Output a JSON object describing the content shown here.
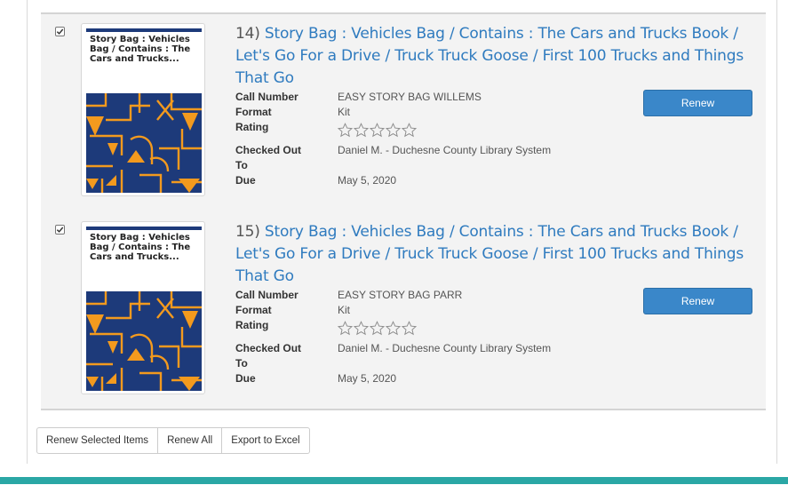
{
  "items": [
    {
      "number": "14)",
      "title_lines": [
        "Story Bag : Vehicles Bag / Contains : The Cars and Trucks Book /",
        "Let's Go For a Drive / Truck Truck Goose / First 100 Trucks and Things",
        "That Go"
      ],
      "cover_title": "Story Bag : Vehicles\nBag / Contains : The\nCars and Trucks...",
      "checked": true,
      "details": {
        "call_number_label": "Call Number",
        "call_number": "EASY STORY BAG WILLEMS",
        "format_label": "Format",
        "format": "Kit",
        "rating_label": "Rating",
        "rating": 0,
        "checked_out_to_label_1": "Checked Out",
        "checked_out_to_label_2": "To",
        "checked_out_to": "Daniel M. - Duchesne County Library System",
        "due_label": "Due",
        "due": "May 5, 2020"
      },
      "renew_label": "Renew"
    },
    {
      "number": "15)",
      "title_lines": [
        "Story Bag : Vehicles Bag / Contains : The Cars and Trucks Book /",
        "Let's Go For a Drive / Truck Truck Goose / First 100 Trucks and Things",
        "That Go"
      ],
      "cover_title": "Story Bag : Vehicles\nBag / Contains : The\nCars and Trucks...",
      "checked": true,
      "details": {
        "call_number_label": "Call Number",
        "call_number": "EASY STORY BAG PARR",
        "format_label": "Format",
        "format": "Kit",
        "rating_label": "Rating",
        "rating": 0,
        "checked_out_to_label_1": "Checked Out",
        "checked_out_to_label_2": "To",
        "checked_out_to": "Daniel M. - Duchesne County Library System",
        "due_label": "Due",
        "due": "May 5, 2020"
      },
      "renew_label": "Renew"
    }
  ],
  "actions": {
    "renew_selected": "Renew Selected Items",
    "renew_all": "Renew All",
    "export_excel": "Export to Excel"
  },
  "colors": {
    "link": "#2f7bbf",
    "renew_button": "#3a87c9",
    "footer_bar": "#2aa7a5",
    "cover_blue": "#1d3a7a",
    "cover_orange": "#f39a1e"
  },
  "icons": {
    "checkbox": "checkmark-icon",
    "rating": "star-outline-icon"
  }
}
